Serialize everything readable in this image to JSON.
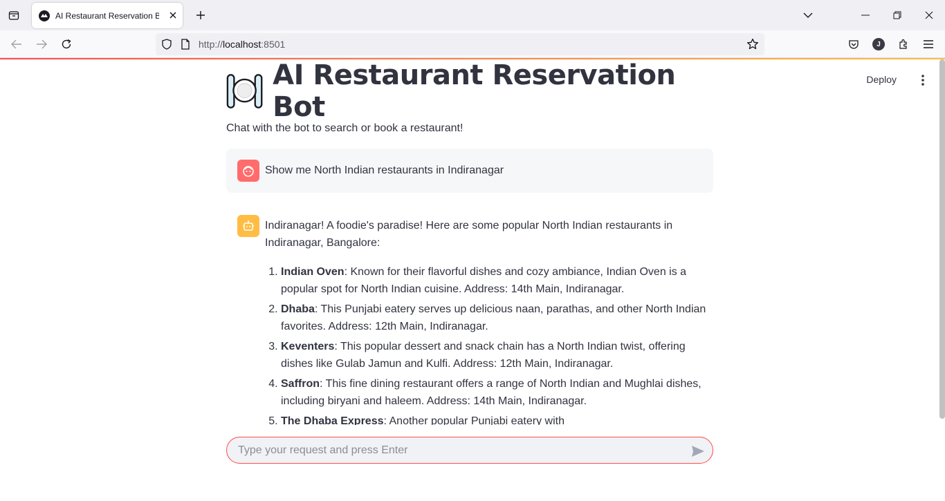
{
  "browser": {
    "tab_title": "AI Restaurant Reservation Bot",
    "url_scheme": "http://",
    "url_host": "localhost",
    "url_rest": ":8501"
  },
  "header": {
    "deploy_label": "Deploy"
  },
  "page": {
    "title": "AI Restaurant Reservation Bot",
    "subtitle": "Chat with the bot to search or book a restaurant!"
  },
  "messages": {
    "user": {
      "text": "Show me North Indian restaurants in Indiranagar"
    },
    "bot": {
      "intro": "Indiranagar! A foodie's paradise! Here are some popular North Indian restaurants in Indiranagar, Bangalore:",
      "items": [
        {
          "name": "Indian Oven",
          "desc": ": Known for their flavorful dishes and cozy ambiance, Indian Oven is a popular spot for North Indian cuisine. Address: 14th Main, Indiranagar."
        },
        {
          "name": "Dhaba",
          "desc": ": This Punjabi eatery serves up delicious naan, parathas, and other North Indian favorites. Address: 12th Main, Indiranagar."
        },
        {
          "name": "Keventers",
          "desc": ": This popular dessert and snack chain has a North Indian twist, offering dishes like Gulab Jamun and Kulfi. Address: 12th Main, Indiranagar."
        },
        {
          "name": "Saffron",
          "desc": ": This fine dining restaurant offers a range of North Indian and Mughlai dishes, including biryani and haleem. Address: 14th Main, Indiranagar."
        },
        {
          "name": "The Dhaba Express",
          "desc": ": Another popular Punjabi eatery with"
        }
      ]
    }
  },
  "chat_input": {
    "placeholder": "Type your request and press Enter"
  },
  "colors": {
    "accent": "#ff4b4b",
    "user_avatar": "#ff6c6c",
    "bot_avatar": "#ffbd45",
    "text": "#31333f"
  }
}
